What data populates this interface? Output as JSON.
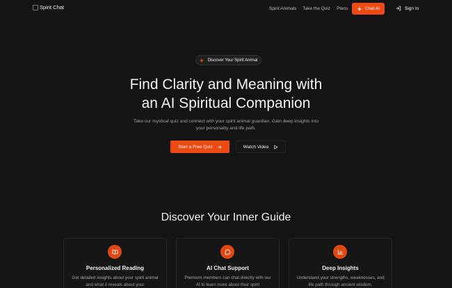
{
  "nav": {
    "logo_alt": "Spirit Chat",
    "links": [
      "Spirit Animals",
      "Take the Quiz",
      "Plans"
    ],
    "chat_button": "Chat AI",
    "signin": "Sign In"
  },
  "hero": {
    "badge": "Discover Your Spirit Animal",
    "title_line1": "Find Clarity and Meaning with",
    "title_line2": "an AI Spiritual Companion",
    "subtitle": "Take our mystical quiz and connect with your spirit animal guardian. Gain deep insights into your personality and life path.",
    "primary_cta": "Start a Free Quiz",
    "secondary_cta": "Watch Video"
  },
  "features": {
    "title": "Discover Your Inner Guide",
    "cards": [
      {
        "title": "Personalized Reading",
        "text": "Get detailed insights about your spirit animal and what it reveals about your",
        "icon": "book-open-icon"
      },
      {
        "title": "AI Chat Support",
        "text": "Premium members can chat directly with our AI to learn more about their spirit",
        "icon": "message-circle-icon"
      },
      {
        "title": "Deep Insights",
        "text": "Understand your strengths, weaknesses, and life path through ancient wisdom.",
        "icon": "chart-icon"
      }
    ]
  },
  "colors": {
    "accent": "#f04a14",
    "background": "#141414"
  }
}
